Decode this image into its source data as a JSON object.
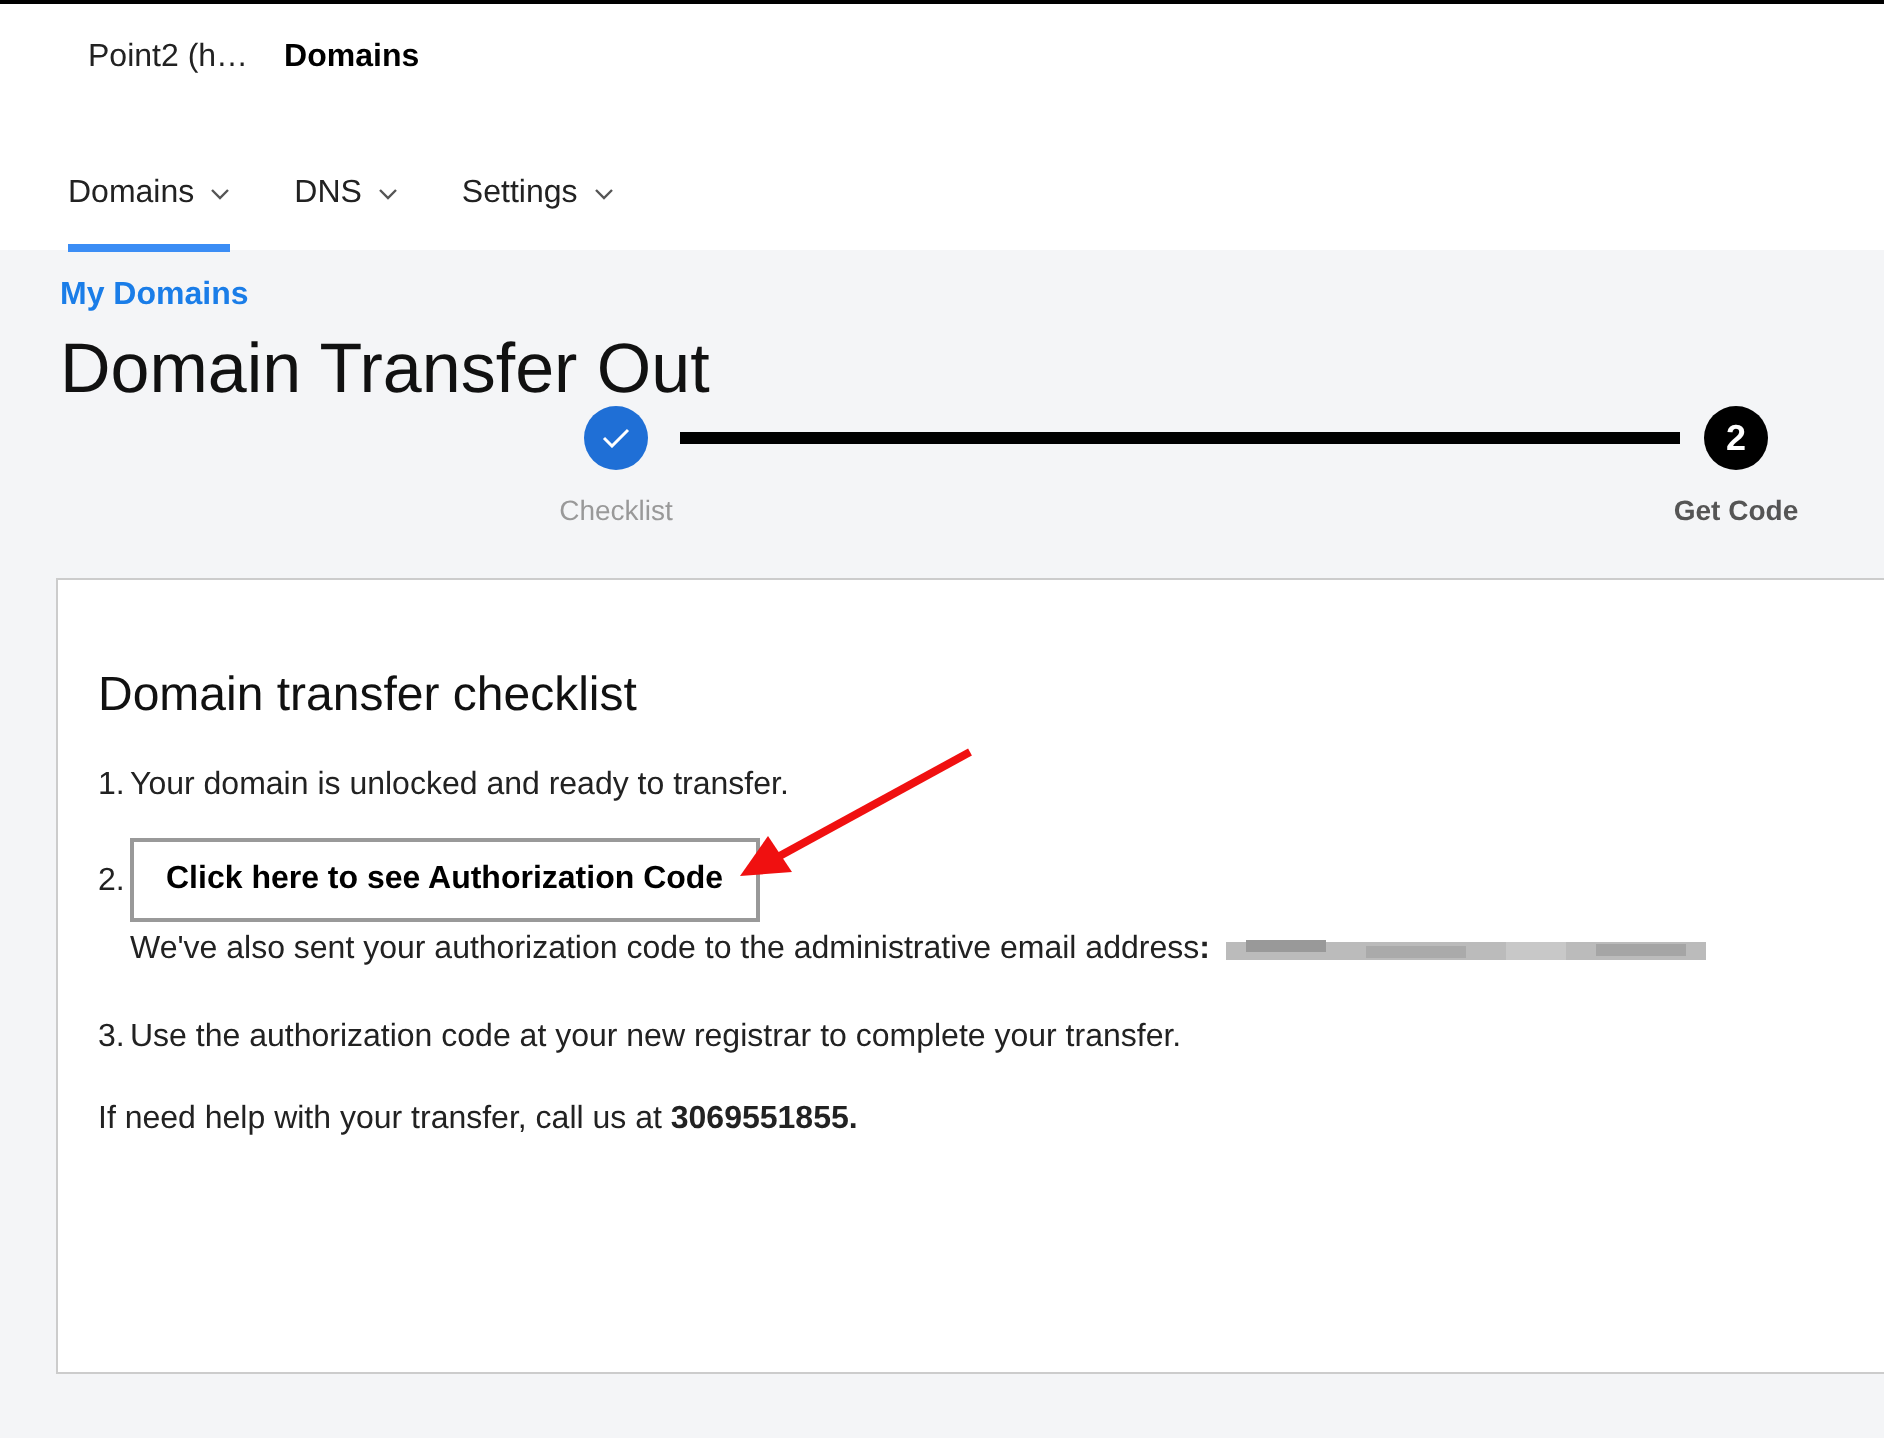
{
  "header": {
    "account": "Point2 (h…",
    "section": "Domains"
  },
  "tabs": [
    {
      "label": "Domains",
      "selected": true
    },
    {
      "label": "DNS",
      "selected": false
    },
    {
      "label": "Settings",
      "selected": false
    }
  ],
  "breadcrumb": "My Domains",
  "title": "Domain Transfer Out",
  "steps": [
    {
      "label": "Checklist",
      "completed": true
    },
    {
      "label": "Get Code",
      "number": "2",
      "completed": false
    }
  ],
  "checklist": {
    "heading": "Domain transfer checklist",
    "items": [
      {
        "number": "1.",
        "kind": "text",
        "text": "Your domain is unlocked and ready to transfer."
      },
      {
        "number": "2.",
        "kind": "button",
        "button": "Click here to see Authorization Code",
        "note": "We've also sent your authorization code to the administrative email address**:**"
      },
      {
        "number": "3.",
        "kind": "text",
        "text": "Use the authorization code at your new registrar to complete your transfer."
      }
    ],
    "help": "If need help with your transfer, call us at **3069551855.**"
  }
}
